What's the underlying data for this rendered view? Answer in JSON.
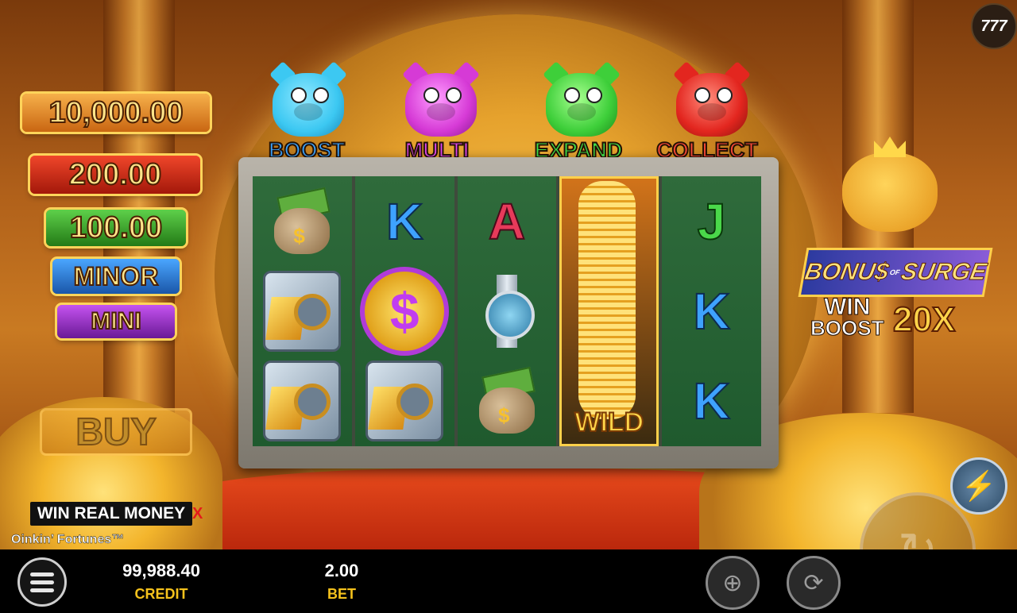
{
  "brand_logo": "777",
  "game_title": "Oinkin’ Fortunes™",
  "jackpots": [
    {
      "label": "10,000.00",
      "color": "#e8811c"
    },
    {
      "label": "200.00",
      "color": "#d72a12"
    },
    {
      "label": "100.00",
      "color": "#3aa028"
    },
    {
      "label": "MINOR",
      "color": "#1f73c9"
    },
    {
      "label": "MINI",
      "color": "#9a2ac4"
    }
  ],
  "pigs": [
    {
      "label": "BOOST",
      "color": "#3cc8f2",
      "text_color": "#3aa3ff"
    },
    {
      "label": "MULTI",
      "color": "#d63ad6",
      "text_color": "#e047f0"
    },
    {
      "label": "EXPAND",
      "color": "#3ecf3a",
      "text_color": "#3fe04a"
    },
    {
      "label": "COLLECT",
      "color": "#e3261f",
      "text_color": "#ff4a3a"
    }
  ],
  "reels": [
    [
      "moneybag-icon",
      "gold-safe-icon",
      "gold-safe-icon"
    ],
    [
      "K",
      "dollar-coin-icon",
      "gold-safe-icon"
    ],
    [
      "A",
      "watch-icon",
      "moneybag-icon"
    ],
    [
      "WILD"
    ],
    [
      "J",
      "K",
      "K"
    ]
  ],
  "bonus_surge": {
    "word1": "BONU$",
    "of": "OF",
    "word2": "SURGE"
  },
  "win_boost": {
    "line1": "WIN",
    "line2": "BOOST",
    "multiplier": "20X"
  },
  "buy_button": "BUY",
  "promo": {
    "label": "WIN REAL MONEY",
    "close": "X"
  },
  "bottom_bar": {
    "credit_value": "99,988.40",
    "credit_label": "CREDIT",
    "bet_value": "2.00",
    "bet_label": "BET"
  },
  "icons": {
    "menu": "hamburger-menu-icon",
    "stake": "coins-plus-icon",
    "autoplay": "autoplay-icon",
    "turbo": "lightning-icon",
    "spin": "spin-icon"
  }
}
